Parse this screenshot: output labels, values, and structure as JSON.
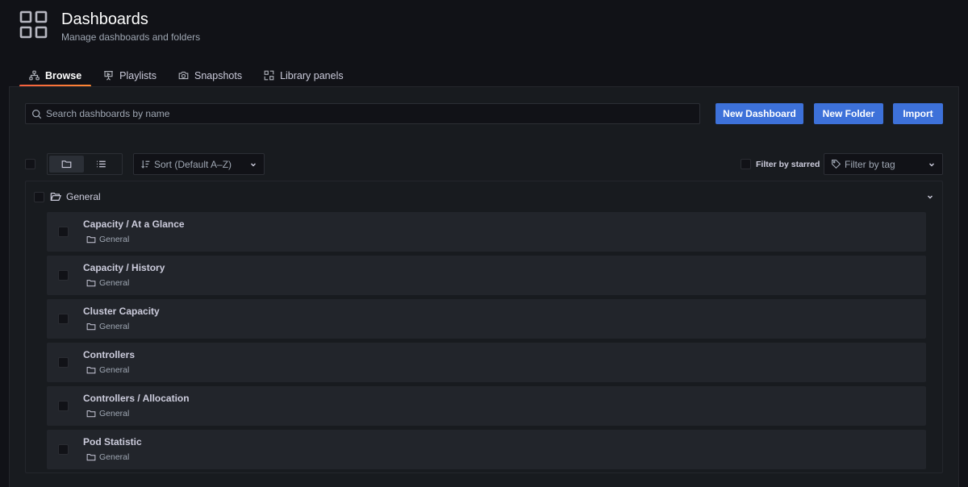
{
  "header": {
    "title": "Dashboards",
    "subtitle": "Manage dashboards and folders",
    "icon": "apps-grid-icon"
  },
  "tabs": [
    {
      "label": "Browse",
      "icon": "sitemap-icon",
      "active": true
    },
    {
      "label": "Playlists",
      "icon": "presentation-icon",
      "active": false
    },
    {
      "label": "Snapshots",
      "icon": "camera-icon",
      "active": false
    },
    {
      "label": "Library panels",
      "icon": "library-panels-icon",
      "active": false
    }
  ],
  "search": {
    "placeholder": "Search dashboards by name",
    "value": ""
  },
  "actions": {
    "new_dashboard": "New Dashboard",
    "new_folder": "New Folder",
    "import": "Import"
  },
  "toolbar": {
    "sort_label": "Sort (Default A–Z)",
    "filter_starred_label": "Filter by starred",
    "filter_tag_placeholder": "Filter by tag",
    "view_mode": "folders"
  },
  "folder": {
    "name": "General",
    "expanded": true,
    "dashboards": [
      {
        "title": "Capacity / At a Glance",
        "folder": "General"
      },
      {
        "title": "Capacity / History",
        "folder": "General"
      },
      {
        "title": "Cluster Capacity",
        "folder": "General"
      },
      {
        "title": "Controllers",
        "folder": "General"
      },
      {
        "title": "Controllers / Allocation",
        "folder": "General"
      },
      {
        "title": "Pod Statistic",
        "folder": "General"
      }
    ]
  },
  "colors": {
    "background": "#111217",
    "panel": "#181b1f",
    "row": "#22252b",
    "primary": "#3d71d9",
    "tab_accent": "#f55f3e"
  }
}
